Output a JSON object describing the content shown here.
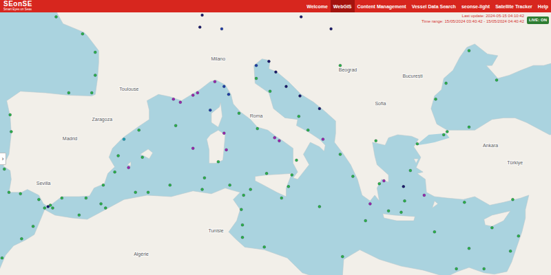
{
  "header": {
    "logo": "SEonSE",
    "tagline": "Smart Eyes on Seas",
    "nav": [
      {
        "label": "Welcome",
        "selected": false
      },
      {
        "label": "WebGIS",
        "selected": true
      },
      {
        "label": "Content Management",
        "selected": false
      },
      {
        "label": "Vessel Data Search",
        "selected": false
      },
      {
        "label": "seonse-light",
        "selected": false
      },
      {
        "label": "Satellite Tracker",
        "selected": false
      },
      {
        "label": "Help",
        "selected": false
      }
    ]
  },
  "status": {
    "last_update": "Last update: 2024-05-15 04:10:42",
    "time_range": "Time range: 15/05/2024 03:40:42 - 15/05/2024 04:40:42",
    "live": {
      "label": "LIVE: ON",
      "on": true
    }
  },
  "sidebar_toggle": "›",
  "map": {
    "labels": [
      {
        "text": "Madrid",
        "lat": 40.4,
        "lon": -3.7
      },
      {
        "text": "Zaragoza",
        "lat": 41.65,
        "lon": -0.9
      },
      {
        "text": "Sevilla",
        "lat": 37.39,
        "lon": -6.0
      },
      {
        "text": "Toulouse",
        "lat": 43.6,
        "lon": 1.44
      },
      {
        "text": "Milano",
        "lat": 45.46,
        "lon": 9.19
      },
      {
        "text": "Roma",
        "lat": 41.9,
        "lon": 12.5
      },
      {
        "text": "Beograd",
        "lat": 44.8,
        "lon": 20.46
      },
      {
        "text": "Sofia",
        "lat": 42.7,
        "lon": 23.3
      },
      {
        "text": "București",
        "lat": 44.43,
        "lon": 26.1
      },
      {
        "text": "Ankara",
        "lat": 39.93,
        "lon": 32.86
      },
      {
        "text": "Tunisie",
        "lat": 34.0,
        "lon": 9.0
      },
      {
        "text": "Algérie",
        "lat": 32.3,
        "lon": 2.5
      },
      {
        "text": "Türkiye",
        "lat": 38.8,
        "lon": 35.0
      }
    ],
    "vessels": [
      {
        "lat": 42.2,
        "lon": -8.9,
        "color": "#2bb24c"
      },
      {
        "lat": 41.1,
        "lon": -8.8,
        "color": "#2bb24c"
      },
      {
        "lat": 39.5,
        "lon": -9.6,
        "color": "#2bb24c"
      },
      {
        "lat": 38.6,
        "lon": -9.4,
        "color": "#2bb24c"
      },
      {
        "lat": 37.0,
        "lon": -9.0,
        "color": "#2bb24c"
      },
      {
        "lat": 36.9,
        "lon": -8.0,
        "color": "#2bb24c"
      },
      {
        "lat": 36.5,
        "lon": -6.4,
        "color": "#2bb24c"
      },
      {
        "lat": 36.1,
        "lon": -5.4,
        "color": "#2bb24c"
      },
      {
        "lat": 36.0,
        "lon": -5.6,
        "color": "#1a1a6e"
      },
      {
        "lat": 35.9,
        "lon": -5.2,
        "color": "#2bb24c"
      },
      {
        "lat": 36.6,
        "lon": -4.4,
        "color": "#2bb24c"
      },
      {
        "lat": 36.6,
        "lon": -2.3,
        "color": "#2bb24c"
      },
      {
        "lat": 37.5,
        "lon": -0.8,
        "color": "#2bb24c"
      },
      {
        "lat": 38.4,
        "lon": 0.2,
        "color": "#2bb24c"
      },
      {
        "lat": 39.5,
        "lon": 0.5,
        "color": "#2bb24c"
      },
      {
        "lat": 41.2,
        "lon": 2.3,
        "color": "#2bb24c"
      },
      {
        "lat": 40.6,
        "lon": 1.0,
        "color": "#17a2b8"
      },
      {
        "lat": 39.4,
        "lon": 2.6,
        "color": "#2bb24c"
      },
      {
        "lat": 38.7,
        "lon": 1.4,
        "color": "#9c27b0"
      },
      {
        "lat": 43.6,
        "lon": -3.8,
        "color": "#2bb24c"
      },
      {
        "lat": 43.6,
        "lon": -1.8,
        "color": "#2bb24c"
      },
      {
        "lat": 44.7,
        "lon": -1.5,
        "color": "#2bb24c"
      },
      {
        "lat": 46.1,
        "lon": -1.5,
        "color": "#2bb24c"
      },
      {
        "lat": 47.2,
        "lon": -2.6,
        "color": "#2bb24c"
      },
      {
        "lat": 48.2,
        "lon": -4.9,
        "color": "#2bb24c"
      },
      {
        "lat": 43.2,
        "lon": 5.3,
        "color": "#9c27b0"
      },
      {
        "lat": 43.0,
        "lon": 5.9,
        "color": "#9c27b0"
      },
      {
        "lat": 43.45,
        "lon": 7.0,
        "color": "#9c27b0"
      },
      {
        "lat": 43.6,
        "lon": 7.4,
        "color": "#9c27b0"
      },
      {
        "lat": 44.3,
        "lon": 8.9,
        "color": "#9c27b0"
      },
      {
        "lat": 44.0,
        "lon": 9.7,
        "color": "#1e3ca8"
      },
      {
        "lat": 43.5,
        "lon": 10.1,
        "color": "#1e3ca8"
      },
      {
        "lat": 42.3,
        "lon": 11.0,
        "color": "#2bb24c"
      },
      {
        "lat": 41.3,
        "lon": 12.6,
        "color": "#2bb24c"
      },
      {
        "lat": 40.7,
        "lon": 14.1,
        "color": "#9c27b0"
      },
      {
        "lat": 40.5,
        "lon": 14.5,
        "color": "#9c27b0"
      },
      {
        "lat": 39.2,
        "lon": 16.0,
        "color": "#2bb24c"
      },
      {
        "lat": 38.2,
        "lon": 15.6,
        "color": "#2bb24c"
      },
      {
        "lat": 38.3,
        "lon": 13.4,
        "color": "#2bb24c"
      },
      {
        "lat": 37.4,
        "lon": 15.3,
        "color": "#2bb24c"
      },
      {
        "lat": 36.6,
        "lon": 14.7,
        "color": "#2bb24c"
      },
      {
        "lat": 39.1,
        "lon": 9.2,
        "color": "#2bb24c"
      },
      {
        "lat": 41.0,
        "lon": 9.7,
        "color": "#9c27b0"
      },
      {
        "lat": 42.5,
        "lon": 8.5,
        "color": "#1e3ca8"
      },
      {
        "lat": 39.9,
        "lon": 9.9,
        "color": "#9c27b0"
      },
      {
        "lat": 40.0,
        "lon": 7.0,
        "color": "#9c27b0"
      },
      {
        "lat": 41.5,
        "lon": 5.5,
        "color": "#2bb24c"
      },
      {
        "lat": 45.55,
        "lon": 13.6,
        "color": "#1a1a6e"
      },
      {
        "lat": 45.3,
        "lon": 12.5,
        "color": "#1e3ca8"
      },
      {
        "lat": 44.5,
        "lon": 12.5,
        "color": "#2bb24c"
      },
      {
        "lat": 43.7,
        "lon": 13.7,
        "color": "#2bb24c"
      },
      {
        "lat": 43.4,
        "lon": 16.3,
        "color": "#1a1a6e"
      },
      {
        "lat": 42.6,
        "lon": 18.0,
        "color": "#1a1a6e"
      },
      {
        "lat": 42.1,
        "lon": 16.2,
        "color": "#2bb24c"
      },
      {
        "lat": 41.2,
        "lon": 17.0,
        "color": "#2bb24c"
      },
      {
        "lat": 40.6,
        "lon": 18.3,
        "color": "#9c27b0"
      },
      {
        "lat": 44.0,
        "lon": 15.1,
        "color": "#1a1a6e"
      },
      {
        "lat": 44.9,
        "lon": 14.2,
        "color": "#1a1a6e"
      },
      {
        "lat": 37.8,
        "lon": 23.6,
        "color": "#9c27b0"
      },
      {
        "lat": 37.6,
        "lon": 23.2,
        "color": "#2bb24c"
      },
      {
        "lat": 37.4,
        "lon": 25.3,
        "color": "#1a1a6e"
      },
      {
        "lat": 36.4,
        "lon": 25.4,
        "color": "#2bb24c"
      },
      {
        "lat": 36.8,
        "lon": 27.1,
        "color": "#9c27b0"
      },
      {
        "lat": 38.5,
        "lon": 25.9,
        "color": "#2bb24c"
      },
      {
        "lat": 40.5,
        "lon": 22.9,
        "color": "#2bb24c"
      },
      {
        "lat": 39.6,
        "lon": 19.8,
        "color": "#2bb24c"
      },
      {
        "lat": 38.1,
        "lon": 20.9,
        "color": "#2bb24c"
      },
      {
        "lat": 36.2,
        "lon": 22.4,
        "color": "#9c27b0"
      },
      {
        "lat": 35.7,
        "lon": 24.0,
        "color": "#2bb24c"
      },
      {
        "lat": 35.6,
        "lon": 25.1,
        "color": "#2bb24c"
      },
      {
        "lat": 40.9,
        "lon": 28.8,
        "color": "#2bb24c"
      },
      {
        "lat": 41.1,
        "lon": 29.1,
        "color": "#2bb24c"
      },
      {
        "lat": 40.3,
        "lon": 26.5,
        "color": "#2bb24c"
      },
      {
        "lat": 41.4,
        "lon": 31.0,
        "color": "#2bb24c"
      },
      {
        "lat": 43.2,
        "lon": 28.1,
        "color": "#2bb24c"
      },
      {
        "lat": 44.2,
        "lon": 29.0,
        "color": "#2bb24c"
      },
      {
        "lat": 46.2,
        "lon": 31.0,
        "color": "#2bb24c"
      },
      {
        "lat": 44.4,
        "lon": 33.4,
        "color": "#2bb24c"
      },
      {
        "lat": 36.3,
        "lon": 30.6,
        "color": "#2bb24c"
      },
      {
        "lat": 36.5,
        "lon": 34.8,
        "color": "#2bb24c"
      },
      {
        "lat": 34.5,
        "lon": 33.0,
        "color": "#2bb24c"
      },
      {
        "lat": 33.9,
        "lon": 35.3,
        "color": "#2bb24c"
      },
      {
        "lat": 32.8,
        "lon": 34.6,
        "color": "#2bb24c"
      },
      {
        "lat": 35.9,
        "lon": -5.9,
        "color": "#2bb24c"
      },
      {
        "lat": 35.4,
        "lon": -2.9,
        "color": "#2bb24c"
      },
      {
        "lat": 35.9,
        "lon": -0.6,
        "color": "#2bb24c"
      },
      {
        "lat": 37.0,
        "lon": 3.1,
        "color": "#2bb24c"
      },
      {
        "lat": 37.2,
        "lon": 7.8,
        "color": "#2bb24c"
      },
      {
        "lat": 37.5,
        "lon": 10.2,
        "color": "#2bb24c"
      },
      {
        "lat": 36.8,
        "lon": 11.4,
        "color": "#2bb24c"
      },
      {
        "lat": 35.8,
        "lon": 11.2,
        "color": "#2bb24c"
      },
      {
        "lat": 34.7,
        "lon": 11.3,
        "color": "#2bb24c"
      },
      {
        "lat": 33.8,
        "lon": 11.3,
        "color": "#2bb24c"
      },
      {
        "lat": 33.1,
        "lon": 13.2,
        "color": "#2bb24c"
      },
      {
        "lat": 32.4,
        "lon": 20.0,
        "color": "#2bb24c"
      },
      {
        "lat": 31.5,
        "lon": 29.9,
        "color": "#2bb24c"
      },
      {
        "lat": 31.5,
        "lon": 32.3,
        "color": "#2bb24c"
      },
      {
        "lat": 33.7,
        "lon": -7.9,
        "color": "#2bb24c"
      },
      {
        "lat": 34.6,
        "lon": -6.9,
        "color": "#2bb24c"
      },
      {
        "lat": 32.3,
        "lon": -9.6,
        "color": "#2bb24c"
      },
      {
        "lat": 37.5,
        "lon": 5.0,
        "color": "#2bb24c"
      },
      {
        "lat": 38.0,
        "lon": 8.0,
        "color": "#2bb24c"
      },
      {
        "lat": 37.2,
        "lon": 12.0,
        "color": "#2bb24c"
      },
      {
        "lat": 36.0,
        "lon": 18.0,
        "color": "#2bb24c"
      },
      {
        "lat": 35.0,
        "lon": 22.0,
        "color": "#2bb24c"
      },
      {
        "lat": 34.2,
        "lon": 28.0,
        "color": "#2bb24c"
      },
      {
        "lat": 33.0,
        "lon": 31.0,
        "color": "#2bb24c"
      },
      {
        "lat": 37.0,
        "lon": 2.0,
        "color": "#2bb24c"
      },
      {
        "lat": 36.2,
        "lon": -1.0,
        "color": "#2bb24c"
      },
      {
        "lat": 48.2,
        "lon": 16.4,
        "color": "#1a1a6e"
      },
      {
        "lat": 47.5,
        "lon": 19.0,
        "color": "#1a1a6e"
      },
      {
        "lat": 45.3,
        "lon": 19.8,
        "color": "#2bb24c"
      },
      {
        "lat": 47.5,
        "lon": 9.5,
        "color": "#1e3ca8"
      },
      {
        "lat": 48.3,
        "lon": 7.8,
        "color": "#1a1a6e"
      },
      {
        "lat": 47.6,
        "lon": 7.6,
        "color": "#1a1a6e"
      }
    ]
  }
}
